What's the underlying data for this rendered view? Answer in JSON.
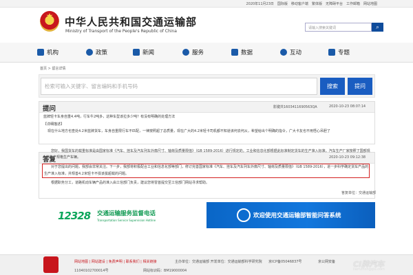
{
  "topbar": {
    "date": "2020年11月23日",
    "links": [
      "国际版",
      "移动客户端",
      "繁体版",
      "无障碍平台",
      "工作邮箱",
      "网站地图"
    ]
  },
  "header": {
    "title": "中华人民共和国交通运输部",
    "subtitle": "Ministry of Transport of the People's Republic of China",
    "search_placeholder": "请输入搜索关键词",
    "search_icon": "search-icon"
  },
  "nav": [
    {
      "label": "机构",
      "icon": "building-icon"
    },
    {
      "label": "政策",
      "icon": "document-icon"
    },
    {
      "label": "新闻",
      "icon": "news-icon"
    },
    {
      "label": "服务",
      "icon": "grid-icon"
    },
    {
      "label": "数据",
      "icon": "chart-icon"
    },
    {
      "label": "互动",
      "icon": "chat-icon"
    },
    {
      "label": "专题",
      "icon": "book-icon"
    }
  ],
  "breadcrumb": "首页 > 留言详情",
  "search": {
    "placeholder": "检索可输入关键字、留言编码和手机号码",
    "search_button": "搜索",
    "ask_button": "提问"
  },
  "question": {
    "heading": "提问",
    "id": "影键共1603411690563QA",
    "datetime": "2020-10-23 08:07:14",
    "body1": "蓝牌轻卡车身自重4.4吨，行车牛2吨多，这种车型该拉多少吨？有没有明确的处理方法",
    "detail_label": "【详细描述】",
    "body2": "现在什么地方也查处4.2米蓝牌货车，车身自重限行车不匹配，一律按照超了总质量，现在广大的4.2米轻卡司机都不知道该何去何从，希望给出个明确的指令，广大卡友也不用悟心吊胆了"
  },
  "answer": {
    "heading": "答复",
    "datetime": "2020-10-23 09:12:38",
    "para1": "您好，我国货车的载重标准是由国家标准《汽车、挂车及汽车列车外廓尺寸、轴荷及质量限值》（GB 1589-2016）进行规定的，工业和信息化部根据此标准制定货车的生产准入标准，汽车生产厂家按照了国部规令的生产规格生产车辆。",
    "para2": "对于您提出的问题，我部会非常关注。下一步，我部将积极配合工业和信息化部等部门，修订完善国家标准《汽车、挂车及汽车列车外廓尺寸、轴荷及质量限值》（GB 1589-2016），进一步科学确定货车产品的生产准入标准，并规善4.2米轻卡不损该拔超载的问题。",
    "para3": "根据职务分工，道路机动车辆产品的准入由工信部门负责，建议您将冒首提交至工信部门网站寻求帮助。",
    "signature": "答复单位：交通运输部"
  },
  "banners": {
    "left_logo": "12328",
    "left_title": "交通运输服务监督电话",
    "left_sub": "Transportation Service Supervision Hotline",
    "right_title": "欢迎使用交通运输部智能问答系统"
  },
  "footer": {
    "links": "网站地图 | 网站建设 | 免费声明 | 联系我们 | 相关链接",
    "host": "主办单位：交通运输部  开发单位：交通运输部科学研究院",
    "icp": "京ICP备05046837号",
    "police": "京公网安备",
    "code": "11040102700014号",
    "site_code": "网站标识码：BM19000004"
  },
  "watermark": {
    "text": "CI牌汽车",
    "sub": "liamzhongqiu.com"
  },
  "colors": {
    "brand_blue": "#1a5dc1",
    "banner_green": "#109a52",
    "highlight_red": "#d42020",
    "footer_red": "#c8161d"
  }
}
